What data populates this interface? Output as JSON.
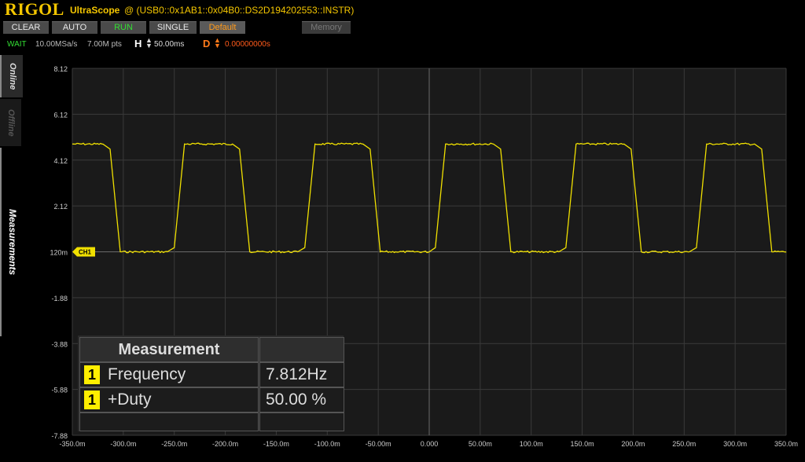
{
  "titlebar": {
    "logo": "RIGOL",
    "app_name": "UltraScope",
    "resource": "@ (USB0::0x1AB1::0x04B0::DS2D194202553::INSTR)"
  },
  "toolbar": {
    "clear": "CLEAR",
    "auto": "AUTO",
    "run": "RUN",
    "single": "SINGLE",
    "default": "Default",
    "memory": "Memory"
  },
  "status": {
    "state": "WAIT",
    "sample_rate": "10.00MSa/s",
    "mem_depth": "7.00M pts",
    "h_label": "H",
    "h_value": "50.00ms",
    "d_label": "D",
    "d_value": "0.00000000s"
  },
  "sidebar": {
    "tabs": [
      "Online",
      "Offline",
      "Measurements"
    ]
  },
  "colors": {
    "trace": "#f0e000",
    "grid": "#3a3a3a",
    "background": "#1a1a1a",
    "accent": "#f4c600"
  },
  "chart_data": {
    "type": "line",
    "title": "",
    "xlabel": "",
    "ylabel": "",
    "xlim": [
      -350.0,
      350.0
    ],
    "ylim": [
      -7.88,
      8.12
    ],
    "x_ticks": [
      "-350.0m",
      "-300.0m",
      "-250.0m",
      "-200.0m",
      "-150.0m",
      "-100.0m",
      "-50.00m",
      "0.000",
      "50.00m",
      "100.0m",
      "150.0m",
      "200.0m",
      "250.0m",
      "300.0m",
      "350.0m"
    ],
    "y_ticks": [
      "8.12",
      "6.12",
      "4.12",
      "2.12",
      "120m",
      "-1.88",
      "-3.88",
      "-5.88",
      "-7.88"
    ],
    "grid": true,
    "channel_marker": "CH1",
    "series": [
      {
        "name": "CH1",
        "x": [
          -350,
          -320,
          -313,
          -303,
          -290,
          -257,
          -250,
          -240,
          -225,
          -193,
          -186,
          -176,
          -161,
          -129,
          -122,
          -112,
          -97,
          -65,
          -58,
          -48,
          -33,
          0,
          6,
          16,
          31,
          63,
          70,
          80,
          95,
          127,
          134,
          144,
          159,
          191,
          198,
          208,
          223,
          255,
          262,
          272,
          287,
          319,
          326,
          336,
          350
        ],
        "y": [
          4.82,
          4.82,
          4.6,
          0.12,
          0.12,
          0.12,
          0.3,
          4.82,
          4.82,
          4.82,
          4.6,
          0.12,
          0.12,
          0.12,
          0.3,
          4.82,
          4.82,
          4.82,
          4.6,
          0.12,
          0.12,
          0.12,
          0.3,
          4.82,
          4.82,
          4.82,
          4.6,
          0.12,
          0.12,
          0.12,
          0.3,
          4.82,
          4.82,
          4.82,
          4.6,
          0.12,
          0.12,
          0.12,
          0.3,
          4.82,
          4.82,
          4.82,
          4.6,
          0.12,
          0.12
        ]
      }
    ]
  },
  "measurements": {
    "header": "Measurement",
    "rows": [
      {
        "channel": "1",
        "name": "Frequency",
        "value": "7.812Hz"
      },
      {
        "channel": "1",
        "name": "+Duty",
        "value": "50.00 %"
      }
    ]
  }
}
